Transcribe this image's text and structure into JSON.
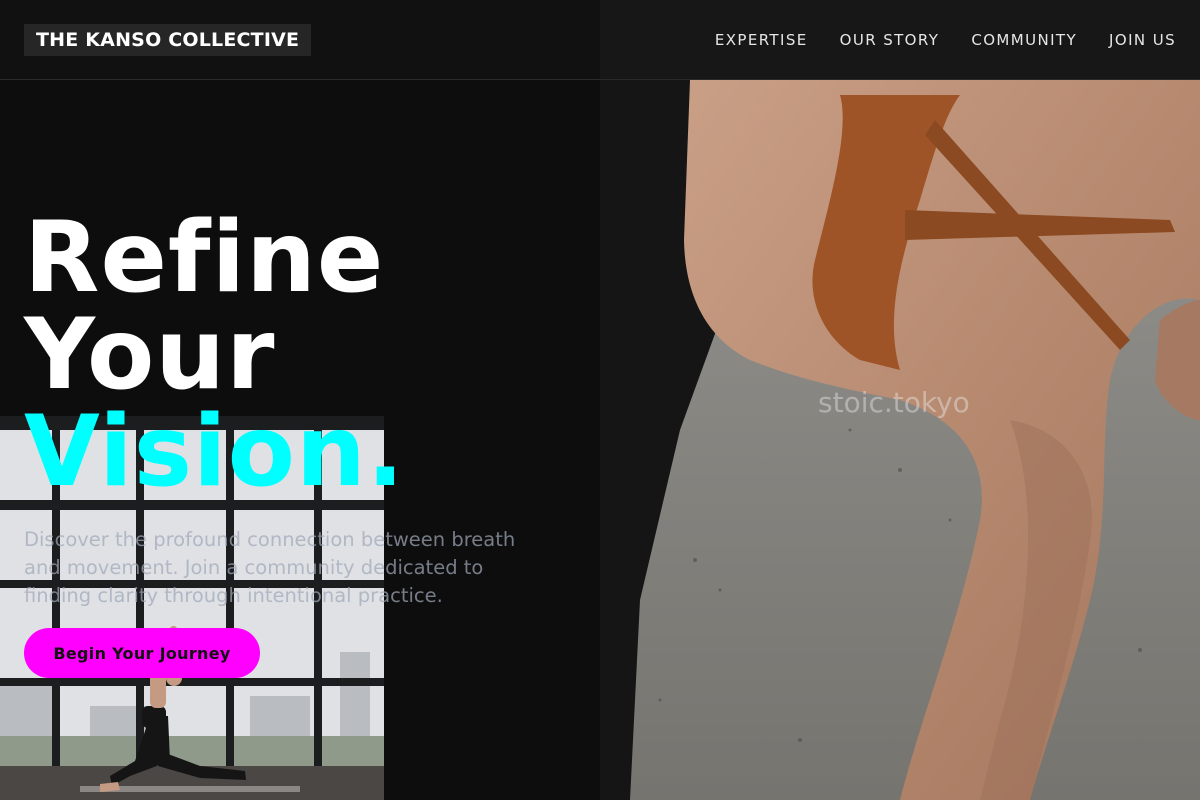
{
  "header": {
    "brand": "THE KANSO COLLECTIVE",
    "nav": [
      {
        "label": "EXPERTISE"
      },
      {
        "label": "OUR STORY"
      },
      {
        "label": "COMMUNITY"
      },
      {
        "label": "JOIN US"
      }
    ]
  },
  "hero": {
    "headline_line1": "Refine",
    "headline_line2": "Your",
    "headline_accent": "Vision.",
    "subtitle": "Discover the profound connection between breath and movement. Join a community dedicated to finding clarity through intentional practice.",
    "cta_label": "Begin Your Journey"
  },
  "photo_right": {
    "watermark": "stoic.tokyo"
  },
  "colors": {
    "accent_cyan": "#00ffff",
    "cta_magenta": "#ff00ff",
    "background": "#0d0d0d"
  }
}
